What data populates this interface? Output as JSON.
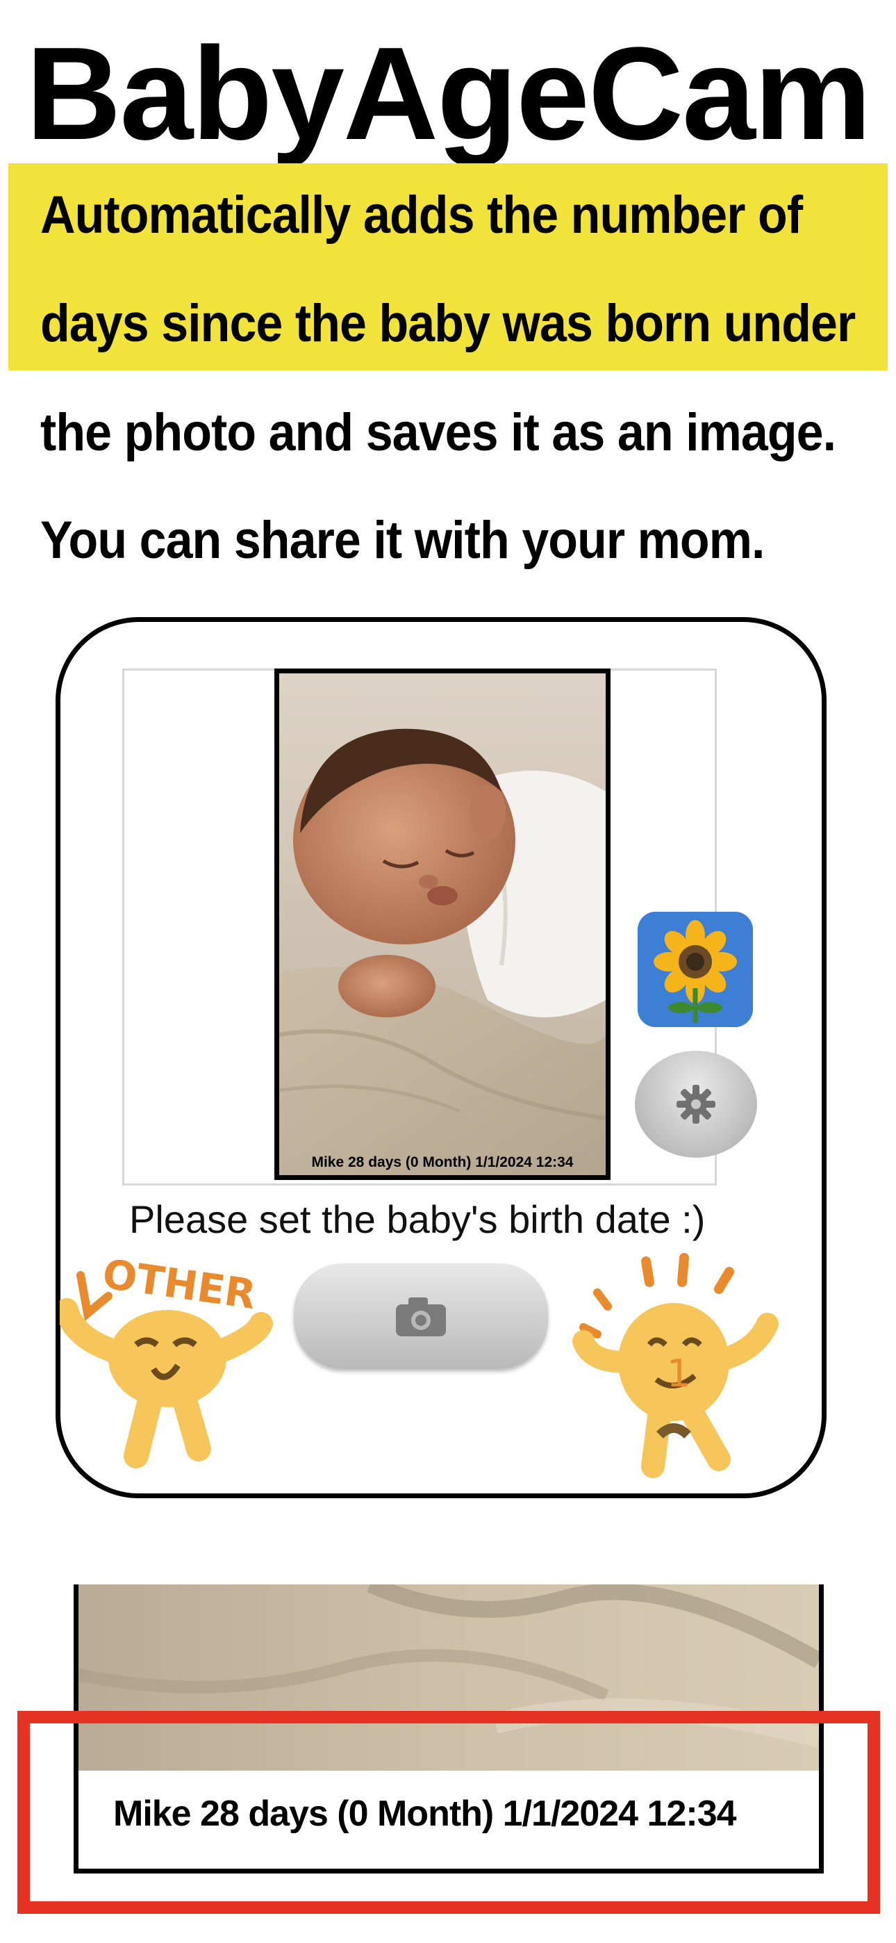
{
  "header": {
    "title": "BabyAgeCam",
    "description_lines": [
      "Automatically adds the number of",
      "days since the baby was born under",
      "the photo and saves it as an image.",
      "You can share it with your mom."
    ],
    "highlight_color": "#f1e33a"
  },
  "app": {
    "photo_caption": "Mike 28 days (0  Month) 1/1/2024  12:34",
    "hint_text": "Please set the baby's birth date :)",
    "buttons": {
      "gallery_icon": "sunflower-icon",
      "settings_icon": "gear-icon",
      "shutter_icon": "camera-icon"
    },
    "stickers": {
      "left_text": "OTHER",
      "right_text": "1"
    }
  },
  "zoom": {
    "caption": "Mike 28 days (0  Month) 1/1/2024  12:34",
    "highlight_color": "#e63222"
  }
}
